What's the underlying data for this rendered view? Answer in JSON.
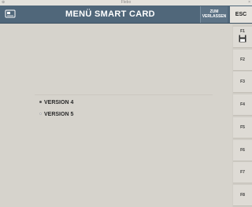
{
  "window": {
    "title": "Flebo",
    "close_glyph": "×",
    "dot": "⊕"
  },
  "header": {
    "icon": "smart-card-icon",
    "title": "MENÜ SMART CARD",
    "exit_line1": "ZUM",
    "exit_line2": "VERLASSEN",
    "esc_label": "ESC",
    "background_color": "#50677a"
  },
  "options": [
    {
      "label": "VERSION 4",
      "selected": true
    },
    {
      "label": "VERSION 5",
      "selected": false
    }
  ],
  "function_keys": [
    {
      "label": "F1",
      "icon": "save-icon"
    },
    {
      "label": "F2"
    },
    {
      "label": "F3"
    },
    {
      "label": "F4"
    },
    {
      "label": "F5"
    },
    {
      "label": "F6"
    },
    {
      "label": "F7"
    },
    {
      "label": "F8"
    }
  ]
}
